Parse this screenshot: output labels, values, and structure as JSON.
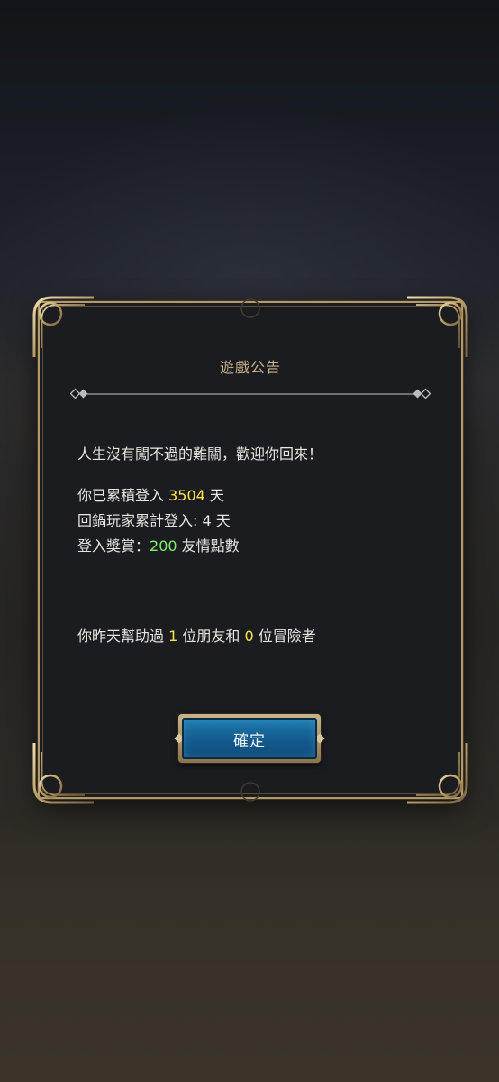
{
  "dialog": {
    "title": "遊戲公告",
    "greeting": "人生沒有闖不過的難關，歡迎你回來！",
    "cumulative_login": {
      "prefix": "你已累積登入 ",
      "value": "3504",
      "suffix": " 天"
    },
    "returning_login": "回鍋玩家累計登入: 4 天",
    "login_reward": {
      "prefix": "登入獎賞：",
      "value": "200",
      "suffix": " 友情點數"
    },
    "helped": {
      "prefix": "你昨天幫助過 ",
      "friends": "1",
      "middle": " 位朋友和 ",
      "adventurers": "0",
      "suffix": " 位冒險者"
    },
    "confirm_label": "確定"
  },
  "colors": {
    "highlight_yellow": "#ffe34d",
    "highlight_green": "#7ef06e",
    "title_gold": "#c8b089",
    "button_blue": "#145f92"
  }
}
